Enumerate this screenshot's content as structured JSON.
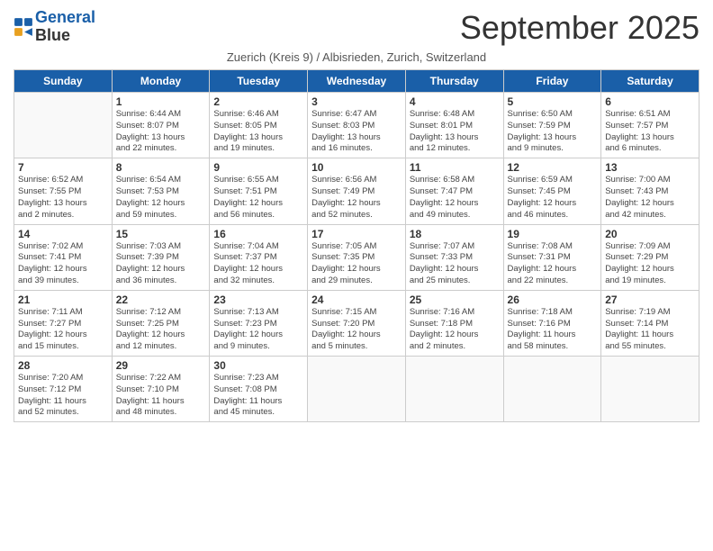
{
  "header": {
    "logo_line1": "General",
    "logo_line2": "Blue",
    "month": "September 2025",
    "subtitle": "Zuerich (Kreis 9) / Albisrieden, Zurich, Switzerland"
  },
  "weekdays": [
    "Sunday",
    "Monday",
    "Tuesday",
    "Wednesday",
    "Thursday",
    "Friday",
    "Saturday"
  ],
  "weeks": [
    [
      {
        "day": "",
        "info": ""
      },
      {
        "day": "1",
        "info": "Sunrise: 6:44 AM\nSunset: 8:07 PM\nDaylight: 13 hours\nand 22 minutes."
      },
      {
        "day": "2",
        "info": "Sunrise: 6:46 AM\nSunset: 8:05 PM\nDaylight: 13 hours\nand 19 minutes."
      },
      {
        "day": "3",
        "info": "Sunrise: 6:47 AM\nSunset: 8:03 PM\nDaylight: 13 hours\nand 16 minutes."
      },
      {
        "day": "4",
        "info": "Sunrise: 6:48 AM\nSunset: 8:01 PM\nDaylight: 13 hours\nand 12 minutes."
      },
      {
        "day": "5",
        "info": "Sunrise: 6:50 AM\nSunset: 7:59 PM\nDaylight: 13 hours\nand 9 minutes."
      },
      {
        "day": "6",
        "info": "Sunrise: 6:51 AM\nSunset: 7:57 PM\nDaylight: 13 hours\nand 6 minutes."
      }
    ],
    [
      {
        "day": "7",
        "info": "Sunrise: 6:52 AM\nSunset: 7:55 PM\nDaylight: 13 hours\nand 2 minutes."
      },
      {
        "day": "8",
        "info": "Sunrise: 6:54 AM\nSunset: 7:53 PM\nDaylight: 12 hours\nand 59 minutes."
      },
      {
        "day": "9",
        "info": "Sunrise: 6:55 AM\nSunset: 7:51 PM\nDaylight: 12 hours\nand 56 minutes."
      },
      {
        "day": "10",
        "info": "Sunrise: 6:56 AM\nSunset: 7:49 PM\nDaylight: 12 hours\nand 52 minutes."
      },
      {
        "day": "11",
        "info": "Sunrise: 6:58 AM\nSunset: 7:47 PM\nDaylight: 12 hours\nand 49 minutes."
      },
      {
        "day": "12",
        "info": "Sunrise: 6:59 AM\nSunset: 7:45 PM\nDaylight: 12 hours\nand 46 minutes."
      },
      {
        "day": "13",
        "info": "Sunrise: 7:00 AM\nSunset: 7:43 PM\nDaylight: 12 hours\nand 42 minutes."
      }
    ],
    [
      {
        "day": "14",
        "info": "Sunrise: 7:02 AM\nSunset: 7:41 PM\nDaylight: 12 hours\nand 39 minutes."
      },
      {
        "day": "15",
        "info": "Sunrise: 7:03 AM\nSunset: 7:39 PM\nDaylight: 12 hours\nand 36 minutes."
      },
      {
        "day": "16",
        "info": "Sunrise: 7:04 AM\nSunset: 7:37 PM\nDaylight: 12 hours\nand 32 minutes."
      },
      {
        "day": "17",
        "info": "Sunrise: 7:05 AM\nSunset: 7:35 PM\nDaylight: 12 hours\nand 29 minutes."
      },
      {
        "day": "18",
        "info": "Sunrise: 7:07 AM\nSunset: 7:33 PM\nDaylight: 12 hours\nand 25 minutes."
      },
      {
        "day": "19",
        "info": "Sunrise: 7:08 AM\nSunset: 7:31 PM\nDaylight: 12 hours\nand 22 minutes."
      },
      {
        "day": "20",
        "info": "Sunrise: 7:09 AM\nSunset: 7:29 PM\nDaylight: 12 hours\nand 19 minutes."
      }
    ],
    [
      {
        "day": "21",
        "info": "Sunrise: 7:11 AM\nSunset: 7:27 PM\nDaylight: 12 hours\nand 15 minutes."
      },
      {
        "day": "22",
        "info": "Sunrise: 7:12 AM\nSunset: 7:25 PM\nDaylight: 12 hours\nand 12 minutes."
      },
      {
        "day": "23",
        "info": "Sunrise: 7:13 AM\nSunset: 7:23 PM\nDaylight: 12 hours\nand 9 minutes."
      },
      {
        "day": "24",
        "info": "Sunrise: 7:15 AM\nSunset: 7:20 PM\nDaylight: 12 hours\nand 5 minutes."
      },
      {
        "day": "25",
        "info": "Sunrise: 7:16 AM\nSunset: 7:18 PM\nDaylight: 12 hours\nand 2 minutes."
      },
      {
        "day": "26",
        "info": "Sunrise: 7:18 AM\nSunset: 7:16 PM\nDaylight: 11 hours\nand 58 minutes."
      },
      {
        "day": "27",
        "info": "Sunrise: 7:19 AM\nSunset: 7:14 PM\nDaylight: 11 hours\nand 55 minutes."
      }
    ],
    [
      {
        "day": "28",
        "info": "Sunrise: 7:20 AM\nSunset: 7:12 PM\nDaylight: 11 hours\nand 52 minutes."
      },
      {
        "day": "29",
        "info": "Sunrise: 7:22 AM\nSunset: 7:10 PM\nDaylight: 11 hours\nand 48 minutes."
      },
      {
        "day": "30",
        "info": "Sunrise: 7:23 AM\nSunset: 7:08 PM\nDaylight: 11 hours\nand 45 minutes."
      },
      {
        "day": "",
        "info": ""
      },
      {
        "day": "",
        "info": ""
      },
      {
        "day": "",
        "info": ""
      },
      {
        "day": "",
        "info": ""
      }
    ]
  ]
}
